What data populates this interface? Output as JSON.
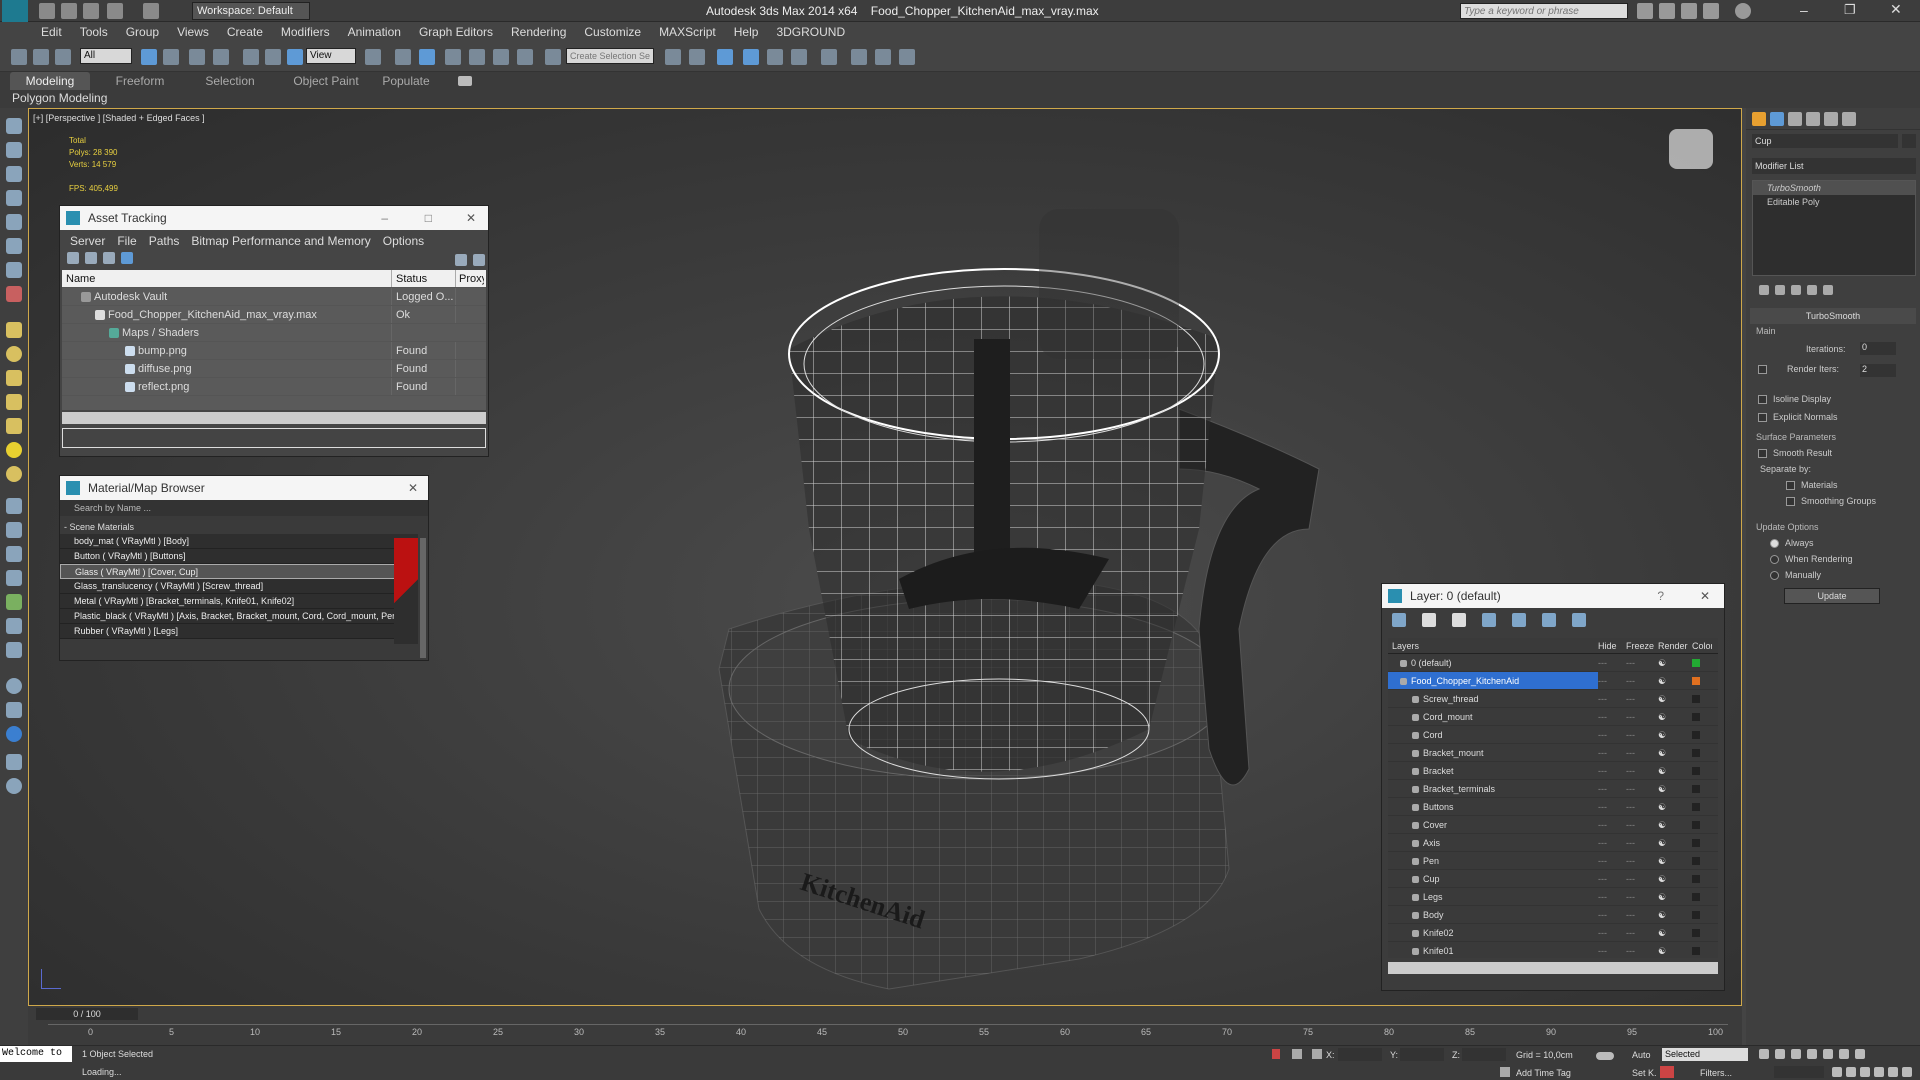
{
  "app": {
    "title": "Autodesk 3ds Max  2014 x64",
    "file": "Food_Chopper_KitchenAid_max_vray.max",
    "workspace": "Workspace: Default",
    "search_placeholder": "Type a keyword or phrase"
  },
  "menu": [
    "Edit",
    "Tools",
    "Group",
    "Views",
    "Create",
    "Modifiers",
    "Animation",
    "Graph Editors",
    "Rendering",
    "Customize",
    "MAXScript",
    "Help",
    "3DGROUND"
  ],
  "toolbar": {
    "filter": "All",
    "view": "View",
    "selection_set": "Create Selection Se"
  },
  "ribbon": {
    "tabs": [
      "Modeling",
      "Freeform",
      "Selection",
      "Object Paint",
      "Populate"
    ],
    "sub": "Polygon Modeling"
  },
  "viewport": {
    "label": "[+] [Perspective ] [Shaded + Edged Faces ]",
    "stats": {
      "total": "Total",
      "polys_label": "Polys:",
      "polys": "28 390",
      "verts_label": "Verts:",
      "verts": "14 579",
      "fps_label": "FPS:",
      "fps": "405,499"
    },
    "brand": "KitchenAid"
  },
  "asset_tracking": {
    "title": "Asset Tracking",
    "menu": [
      "Server",
      "File",
      "Paths",
      "Bitmap Performance and Memory",
      "Options"
    ],
    "cols": [
      "Name",
      "Status",
      "Proxy"
    ],
    "rows": [
      {
        "name": "Autodesk Vault",
        "status": "Logged O..."
      },
      {
        "name": "Food_Chopper_KitchenAid_max_vray.max",
        "status": "Ok"
      },
      {
        "name": "Maps / Shaders",
        "status": ""
      },
      {
        "name": "bump.png",
        "status": "Found"
      },
      {
        "name": "diffuse.png",
        "status": "Found"
      },
      {
        "name": "reflect.png",
        "status": "Found"
      }
    ]
  },
  "material_browser": {
    "title": "Material/Map Browser",
    "search": "Search by Name ...",
    "section": "- Scene Materials",
    "items": [
      "body_mat ( VRayMtl ) [Body]",
      "Button ( VRayMtl ) [Buttons]",
      "Glass ( VRayMtl ) [Cover, Cup]",
      "Glass_translucency ( VRayMtl ) [Screw_thread]",
      "Metal ( VRayMtl ) [Bracket_terminals, Knife01, Knife02]",
      "Plastic_black ( VRayMtl ) [Axis, Bracket, Bracket_mount, Cord, Cord_mount, Pen]",
      "Rubber ( VRayMtl ) [Legs]"
    ]
  },
  "layer": {
    "title": "Layer: 0 (default)",
    "cols": [
      "Layers",
      "Hide",
      "Freeze",
      "Render",
      "Color"
    ],
    "rows": [
      {
        "name": "0 (default)",
        "color": "#22aa33"
      },
      {
        "name": "Food_Chopper_KitchenAid",
        "color": "#e07020"
      },
      {
        "name": "Screw_thread",
        "color": "#222222"
      },
      {
        "name": "Cord_mount",
        "color": "#222222"
      },
      {
        "name": "Cord",
        "color": "#222222"
      },
      {
        "name": "Bracket_mount",
        "color": "#222222"
      },
      {
        "name": "Bracket",
        "color": "#222222"
      },
      {
        "name": "Bracket_terminals",
        "color": "#222222"
      },
      {
        "name": "Buttons",
        "color": "#222222"
      },
      {
        "name": "Cover",
        "color": "#222222"
      },
      {
        "name": "Axis",
        "color": "#222222"
      },
      {
        "name": "Pen",
        "color": "#222222"
      },
      {
        "name": "Cup",
        "color": "#222222"
      },
      {
        "name": "Legs",
        "color": "#222222"
      },
      {
        "name": "Body",
        "color": "#222222"
      },
      {
        "name": "Knife02",
        "color": "#222222"
      },
      {
        "name": "Knife01",
        "color": "#222222"
      }
    ]
  },
  "command_panel": {
    "object_name": "Cup",
    "modifier_list": "Modifier List",
    "stack": [
      "TurboSmooth",
      "Editable Poly"
    ],
    "rollout": "TurboSmooth",
    "main": "Main",
    "iterations_label": "Iterations:",
    "iterations": "0",
    "render_iters_label": "Render Iters:",
    "render_iters": "2",
    "isoline": "Isoline Display",
    "explicit": "Explicit Normals",
    "surface": "Surface Parameters",
    "smooth": "Smooth Result",
    "separate": "Separate by:",
    "materials": "Materials",
    "smoothing": "Smoothing Groups",
    "update_opts": "Update Options",
    "always": "Always",
    "when_rendering": "When Rendering",
    "manually": "Manually",
    "update_btn": "Update"
  },
  "timeline": {
    "frame": "0 / 100",
    "ticks": [
      "0",
      "5",
      "10",
      "15",
      "20",
      "25",
      "30",
      "35",
      "40",
      "45",
      "50",
      "55",
      "60",
      "65",
      "70",
      "75",
      "80",
      "85",
      "90",
      "95",
      "100"
    ]
  },
  "status": {
    "welcome": "Welcome to",
    "selected": "1 Object Selected",
    "loading": "Loading...",
    "grid": "Grid = 10,0cm",
    "add_tag": "Add Time Tag",
    "auto": "Auto",
    "selected_dd": "Selected",
    "setk": "Set K.",
    "filters": "Filters...",
    "x": "X:",
    "y": "Y:",
    "z": "Z:"
  }
}
